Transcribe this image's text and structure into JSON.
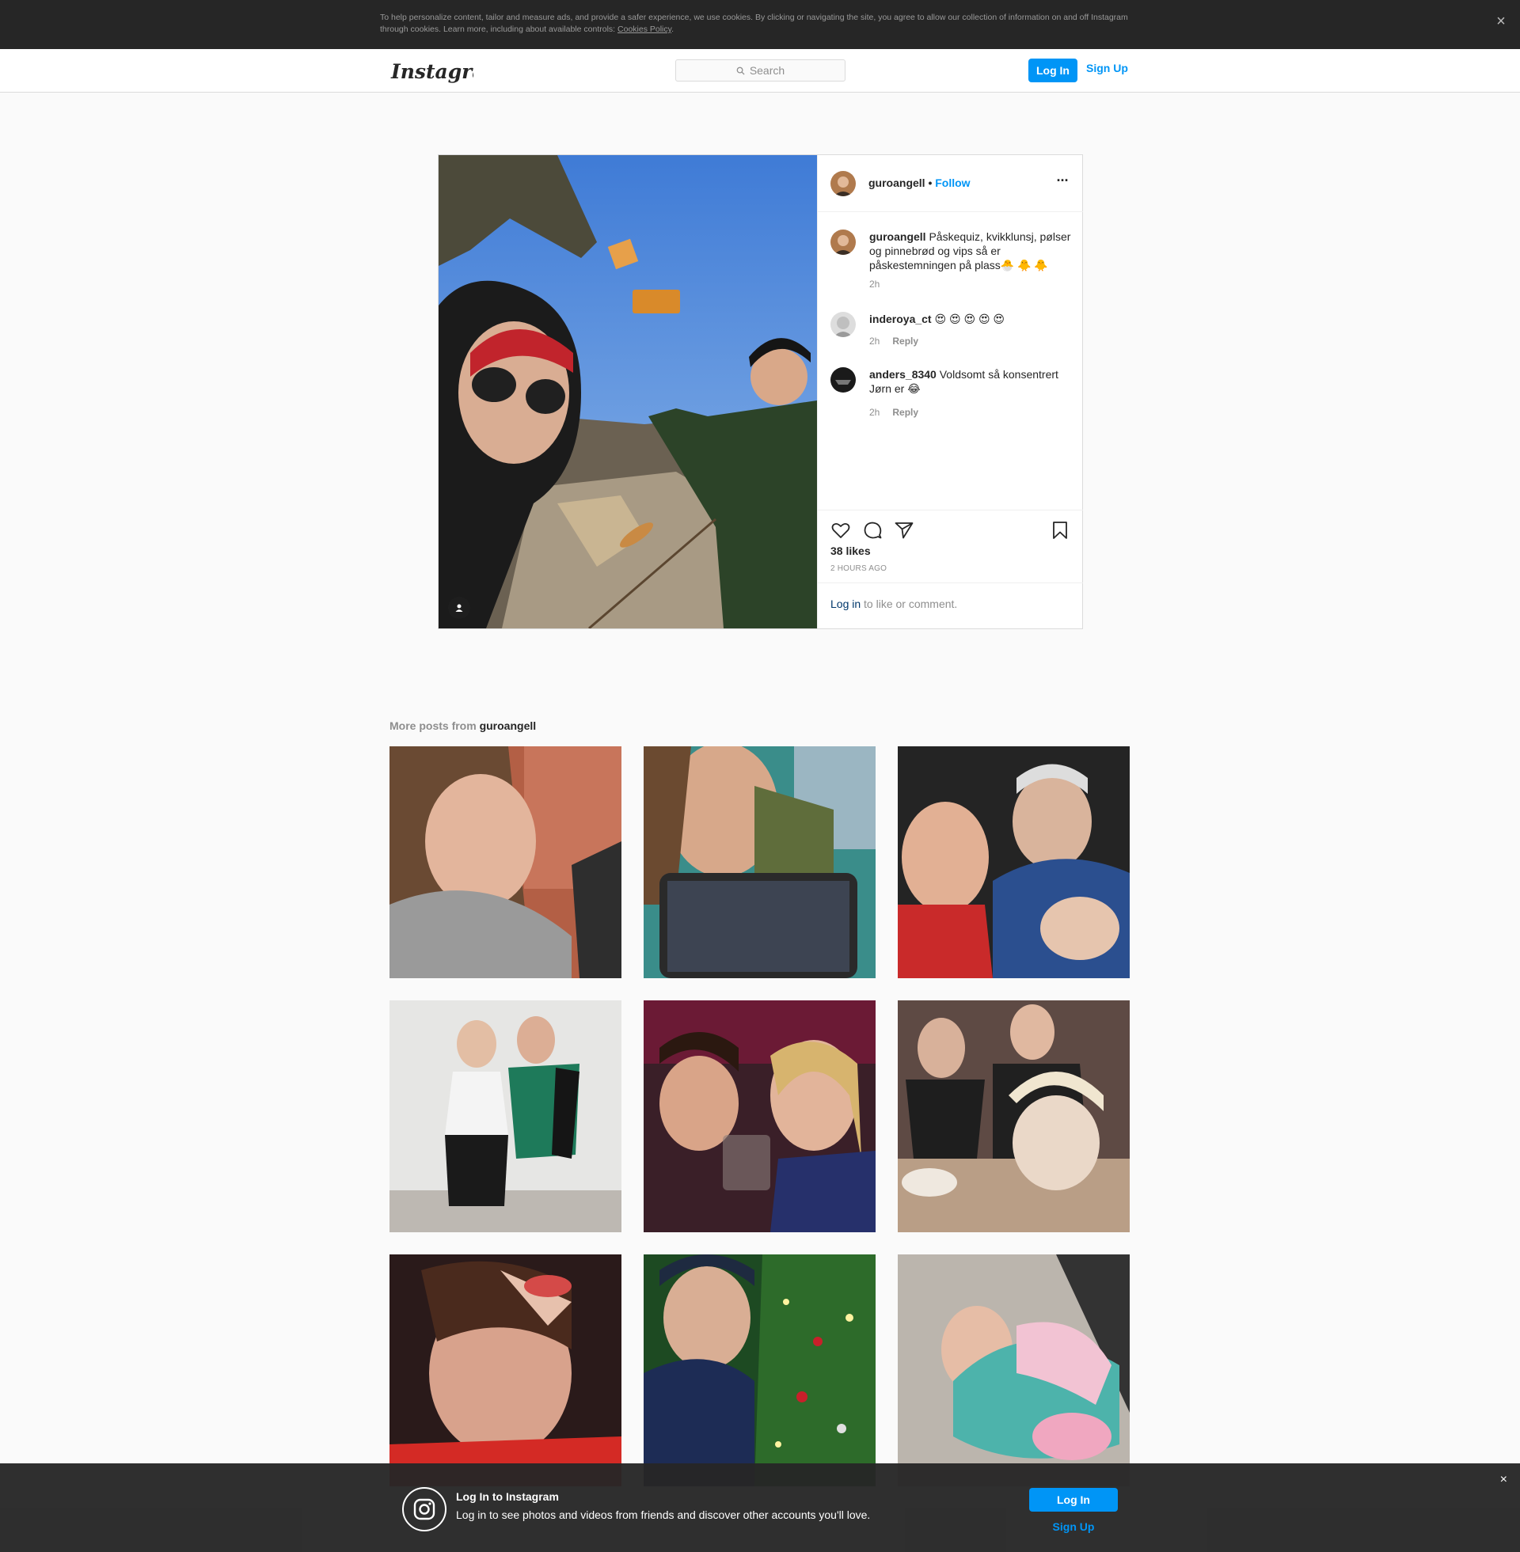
{
  "cookie_banner": {
    "text": "To help personalize content, tailor and measure ads, and provide a safer experience, we use cookies. By clicking or navigating the site, you agree to allow our collection of information on and off Instagram through cookies. Learn more, including about available controls: ",
    "link": "Cookies Policy",
    "end": ".",
    "close": "×"
  },
  "nav": {
    "logo": "Instagram",
    "search_placeholder": "Search",
    "login": "Log In",
    "signup": "Sign Up"
  },
  "post": {
    "username": "guroangell",
    "dot": " • ",
    "follow": "Follow",
    "more": "···",
    "caption_user": "guroangell",
    "caption": "Påskequiz, kvikklunsj, pølser og pinnebrød og vips så er påskestemningen på plass🐣 🐥 🐥",
    "caption_time": "2h",
    "comments": [
      {
        "user": "inderoya_ct",
        "text": "😍 😍 😍 😍 😍",
        "time": "2h",
        "reply": "Reply"
      },
      {
        "user": "anders_8340",
        "text": "Voldsomt så konsentrert Jørn er 😂",
        "time": "2h",
        "reply": "Reply"
      }
    ],
    "likes": "38 likes",
    "posted": "2 HOURS AGO",
    "login_link": "Log in",
    "login_rest": " to like or comment."
  },
  "more_posts": {
    "prefix": "More posts from ",
    "user": "guroangell"
  },
  "bottom_banner": {
    "title": "Log In to Instagram",
    "subtitle": "Log in to see photos and videos from friends and discover other accounts you'll love.",
    "login": "Log In",
    "signup": "Sign Up",
    "close": "×"
  },
  "colors": {
    "accent": "#0095f6",
    "dark_banner": "#262626",
    "border": "#dbdbdb"
  }
}
